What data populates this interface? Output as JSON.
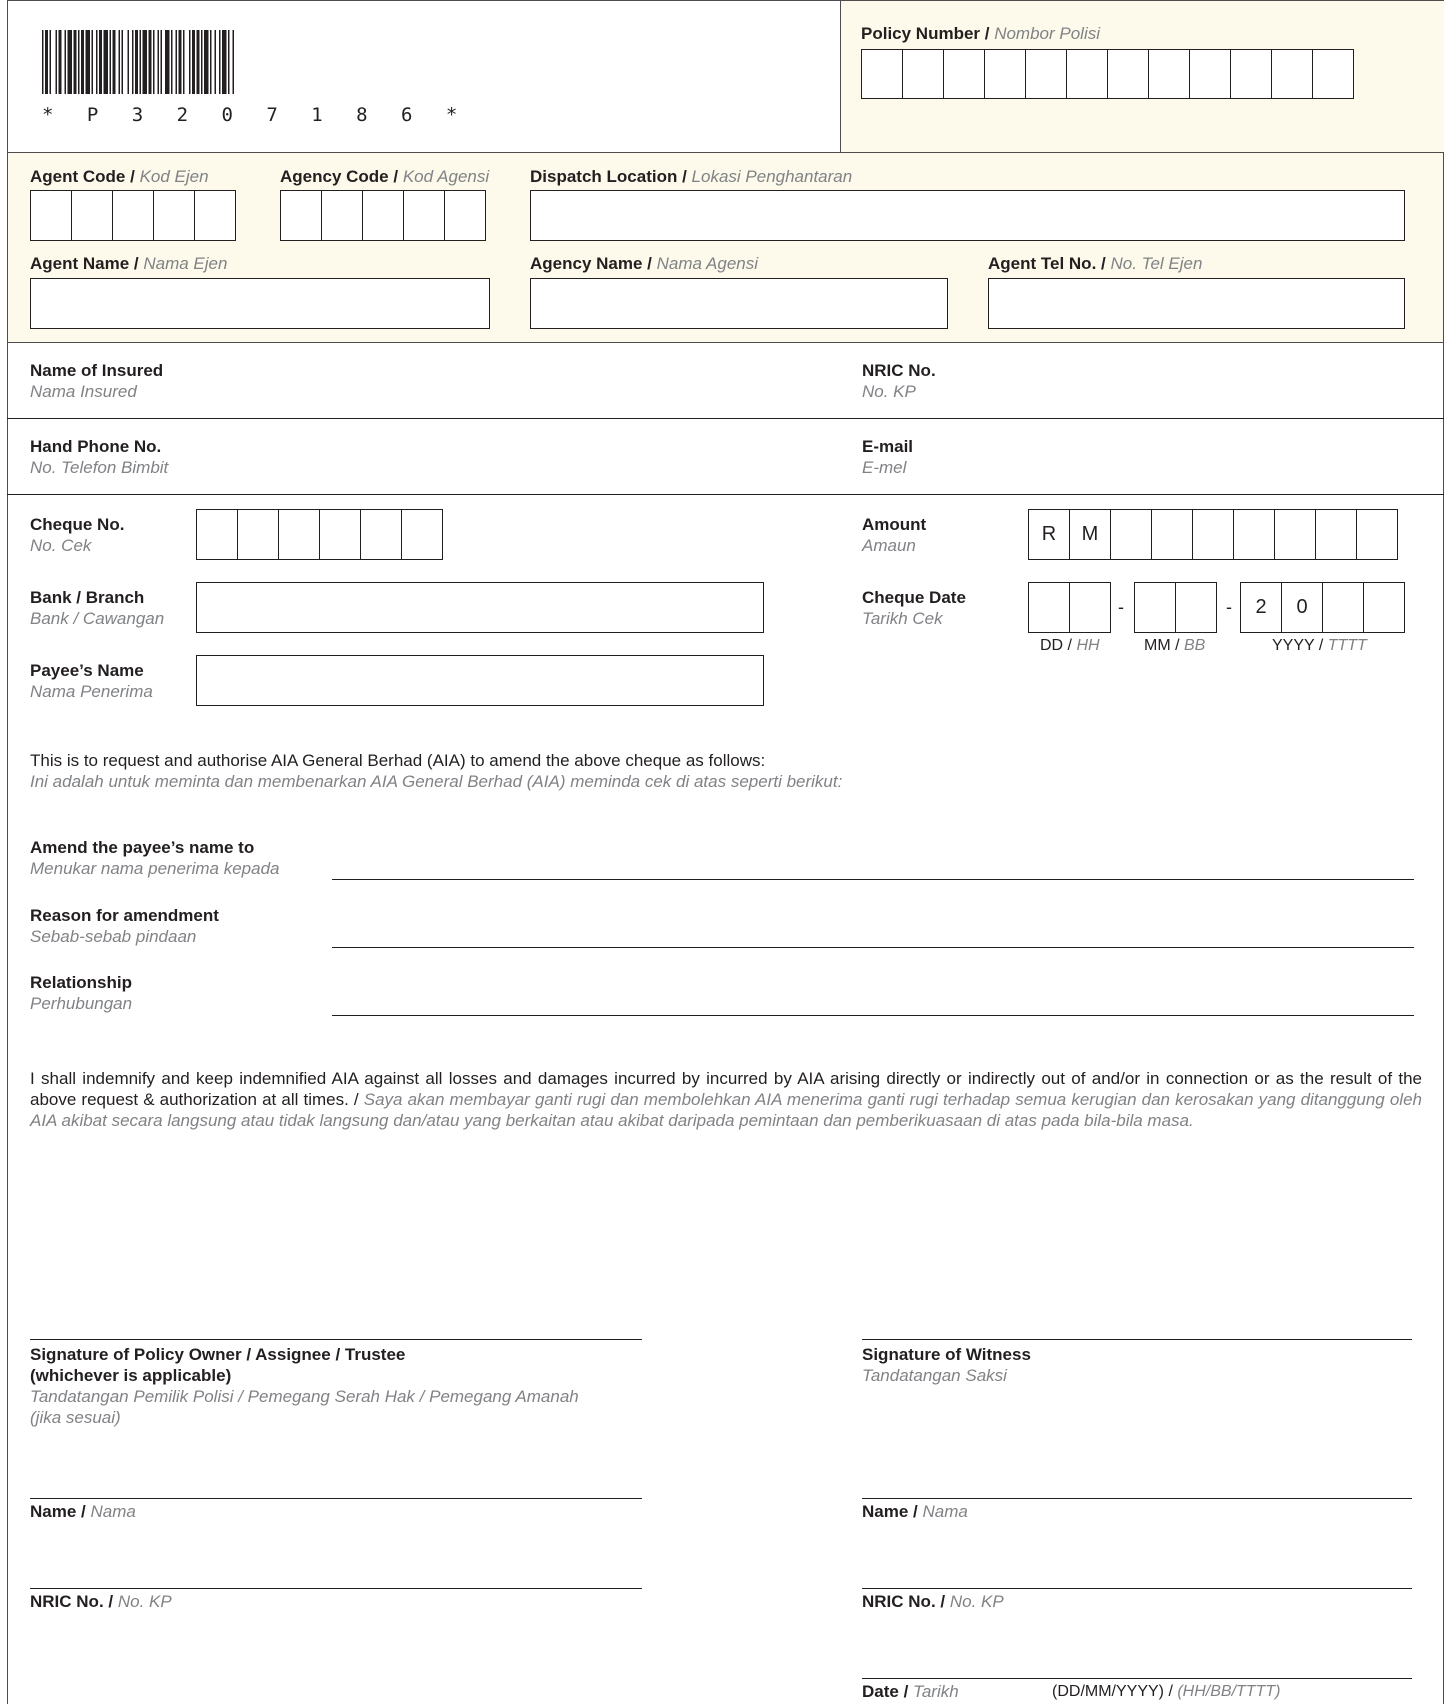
{
  "barcode": {
    "text": "* P 3 2 0 7 1 8 6 *"
  },
  "policy": {
    "label": "Policy Number / ",
    "label_ms": "Nombor Polisi"
  },
  "agent_code": {
    "label": "Agent Code / ",
    "label_ms": "Kod Ejen"
  },
  "agency_code": {
    "label": "Agency Code / ",
    "label_ms": "Kod Agensi"
  },
  "dispatch": {
    "label": "Dispatch Location / ",
    "label_ms": "Lokasi Penghantaran"
  },
  "agent_name": {
    "label": "Agent Name / ",
    "label_ms": "Nama Ejen"
  },
  "agency_name": {
    "label": "Agency Name / ",
    "label_ms": "Nama Agensi"
  },
  "agent_tel": {
    "label": "Agent Tel No. / ",
    "label_ms": "No. Tel Ejen"
  },
  "insured": {
    "label": "Name of Insured",
    "label_ms": "Nama Insured"
  },
  "nric": {
    "label": "NRIC No.",
    "label_ms": "No. KP"
  },
  "phone": {
    "label": "Hand Phone No.",
    "label_ms": "No. Telefon Bimbit"
  },
  "email": {
    "label": "E-mail",
    "label_ms": "E-mel"
  },
  "cheque_no": {
    "label": "Cheque No.",
    "label_ms": "No. Cek"
  },
  "amount": {
    "label": "Amount",
    "label_ms": "Amaun",
    "cell_1": "R",
    "cell_2": "M"
  },
  "bank": {
    "label": "Bank / Branch",
    "label_ms": "Bank / Cawangan"
  },
  "cheque_date": {
    "label": "Cheque Date",
    "label_ms": "Tarikh Cek",
    "dash": "-",
    "year_1": "2",
    "year_2": "0",
    "dd": "DD / ",
    "dd_ms": "HH",
    "mm": "MM / ",
    "mm_ms": "BB",
    "yyyy": "YYYY / ",
    "yyyy_ms": "TTTT"
  },
  "payee": {
    "label": "Payee’s Name",
    "label_ms": "Nama Penerima"
  },
  "request": {
    "text": "This is to request and authorise AIA General Berhad (AIA) to amend the above cheque as follows:",
    "text_ms": "Ini adalah untuk meminta dan membenarkan AIA General Berhad (AIA) meminda cek di atas seperti berikut:"
  },
  "amend_payee": {
    "label": "Amend the payee’s name to",
    "label_ms": "Menukar nama penerima kepada"
  },
  "reason": {
    "label": "Reason for amendment",
    "label_ms": "Sebab-sebab pindaan"
  },
  "relationship": {
    "label": "Relationship",
    "label_ms": "Perhubungan"
  },
  "indemnity": {
    "text": "I shall indemnify and keep indemnified AIA against all losses and damages incurred by incurred by AIA arising directly or indirectly out of and/or in connection or as the result of the above request & authorization at all times. / ",
    "text_ms": "Saya akan membayar ganti rugi dan membolehkan AIA menerima ganti rugi terhadap semua kerugian dan kerosakan yang ditanggung oleh AIA akibat secara langsung atau tidak langsung dan/atau yang berkaitan atau akibat daripada pemintaan dan pemberikuasaan di atas pada bila-bila masa."
  },
  "sig_owner": {
    "line1": "Signature of Policy Owner / Assignee / Trustee",
    "line2": "(whichever is applicable)",
    "ms1": "Tandatangan Pemilik Polisi / Pemegang Serah Hak / Pemegang Amanah",
    "ms2": "(jika sesuai)"
  },
  "sig_witness": {
    "label": "Signature of Witness",
    "label_ms": "Tandatangan Saksi"
  },
  "name_left": {
    "label": "Name / ",
    "label_ms": "Nama"
  },
  "name_right": {
    "label": "Name / ",
    "label_ms": "Nama"
  },
  "nric_left": {
    "label": "NRIC No. / ",
    "label_ms": "No. KP"
  },
  "nric_right": {
    "label": "NRIC No. / ",
    "label_ms": "No. KP"
  },
  "date": {
    "label": "Date / ",
    "label_ms": "Tarikh",
    "format": "(DD/MM/YYYY) / ",
    "format_ms": "(HH/BB/TTTT)"
  },
  "colors": {
    "header_bg": "#fdfaeb",
    "line": "#231f20",
    "malay_text": "#808285"
  }
}
